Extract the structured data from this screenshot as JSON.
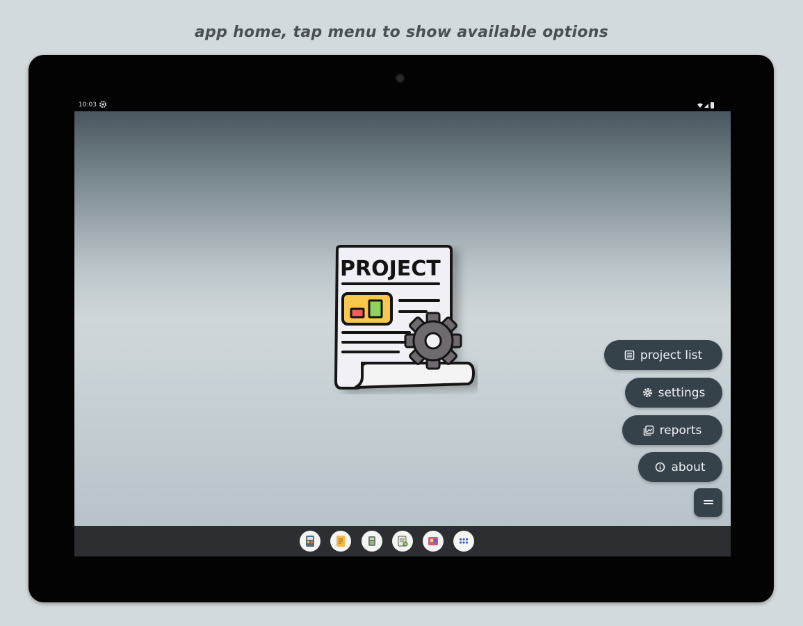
{
  "caption": "app home, tap menu to show available options",
  "status_bar": {
    "time": "10:03"
  },
  "app": {
    "logo_text": "PROJECT"
  },
  "menu": {
    "items": [
      {
        "label": "project list",
        "icon": "list-icon"
      },
      {
        "label": "settings",
        "icon": "gear-icon"
      },
      {
        "label": "reports",
        "icon": "reports-icon"
      },
      {
        "label": "about",
        "icon": "info-icon"
      }
    ],
    "toggle_icon": "menu-icon"
  },
  "dock": {
    "apps": [
      "calculator-app-icon",
      "notes-app-icon",
      "storage-app-icon",
      "document-app-icon",
      "media-app-icon",
      "app-drawer-icon"
    ]
  },
  "colors": {
    "page_bg": "#d3dadd",
    "menu_button": "#35424a",
    "menu_text": "#f0f3f5",
    "tablet_bezel": "#030303"
  }
}
